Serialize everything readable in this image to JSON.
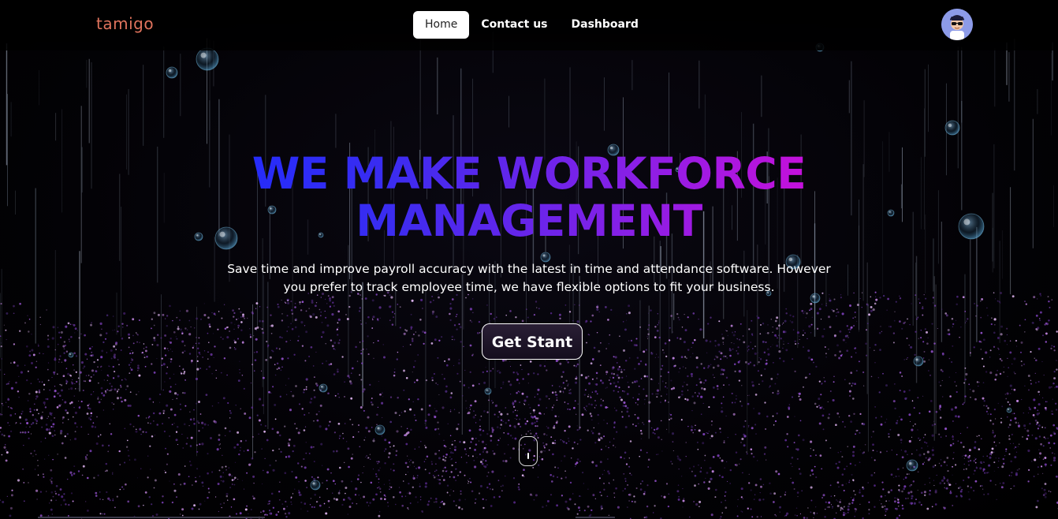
{
  "brand": {
    "logo_text": "tamigo",
    "logo_color": "#e0735d"
  },
  "nav": {
    "items": [
      {
        "label": "Home",
        "active": true
      },
      {
        "label": "Contact us",
        "active": false
      },
      {
        "label": "Dashboard",
        "active": false
      }
    ]
  },
  "avatar": {
    "icon": "user-avatar-icon"
  },
  "hero": {
    "title_line1": "WE MAKE WORKFORCE",
    "title_line2": "MANAGEMENT",
    "subtitle_line1": "Save time and improve payroll accuracy with the latest in time and attendance software. However",
    "subtitle_line2": "you prefer to track employee time, we have flexible options to fit your business.",
    "cta_label": "Get Stant",
    "gradient_colors": [
      "#1a2bff",
      "#8a1fe6",
      "#e00ad6"
    ]
  },
  "scroll": {
    "icon": "mouse-scroll-icon"
  }
}
